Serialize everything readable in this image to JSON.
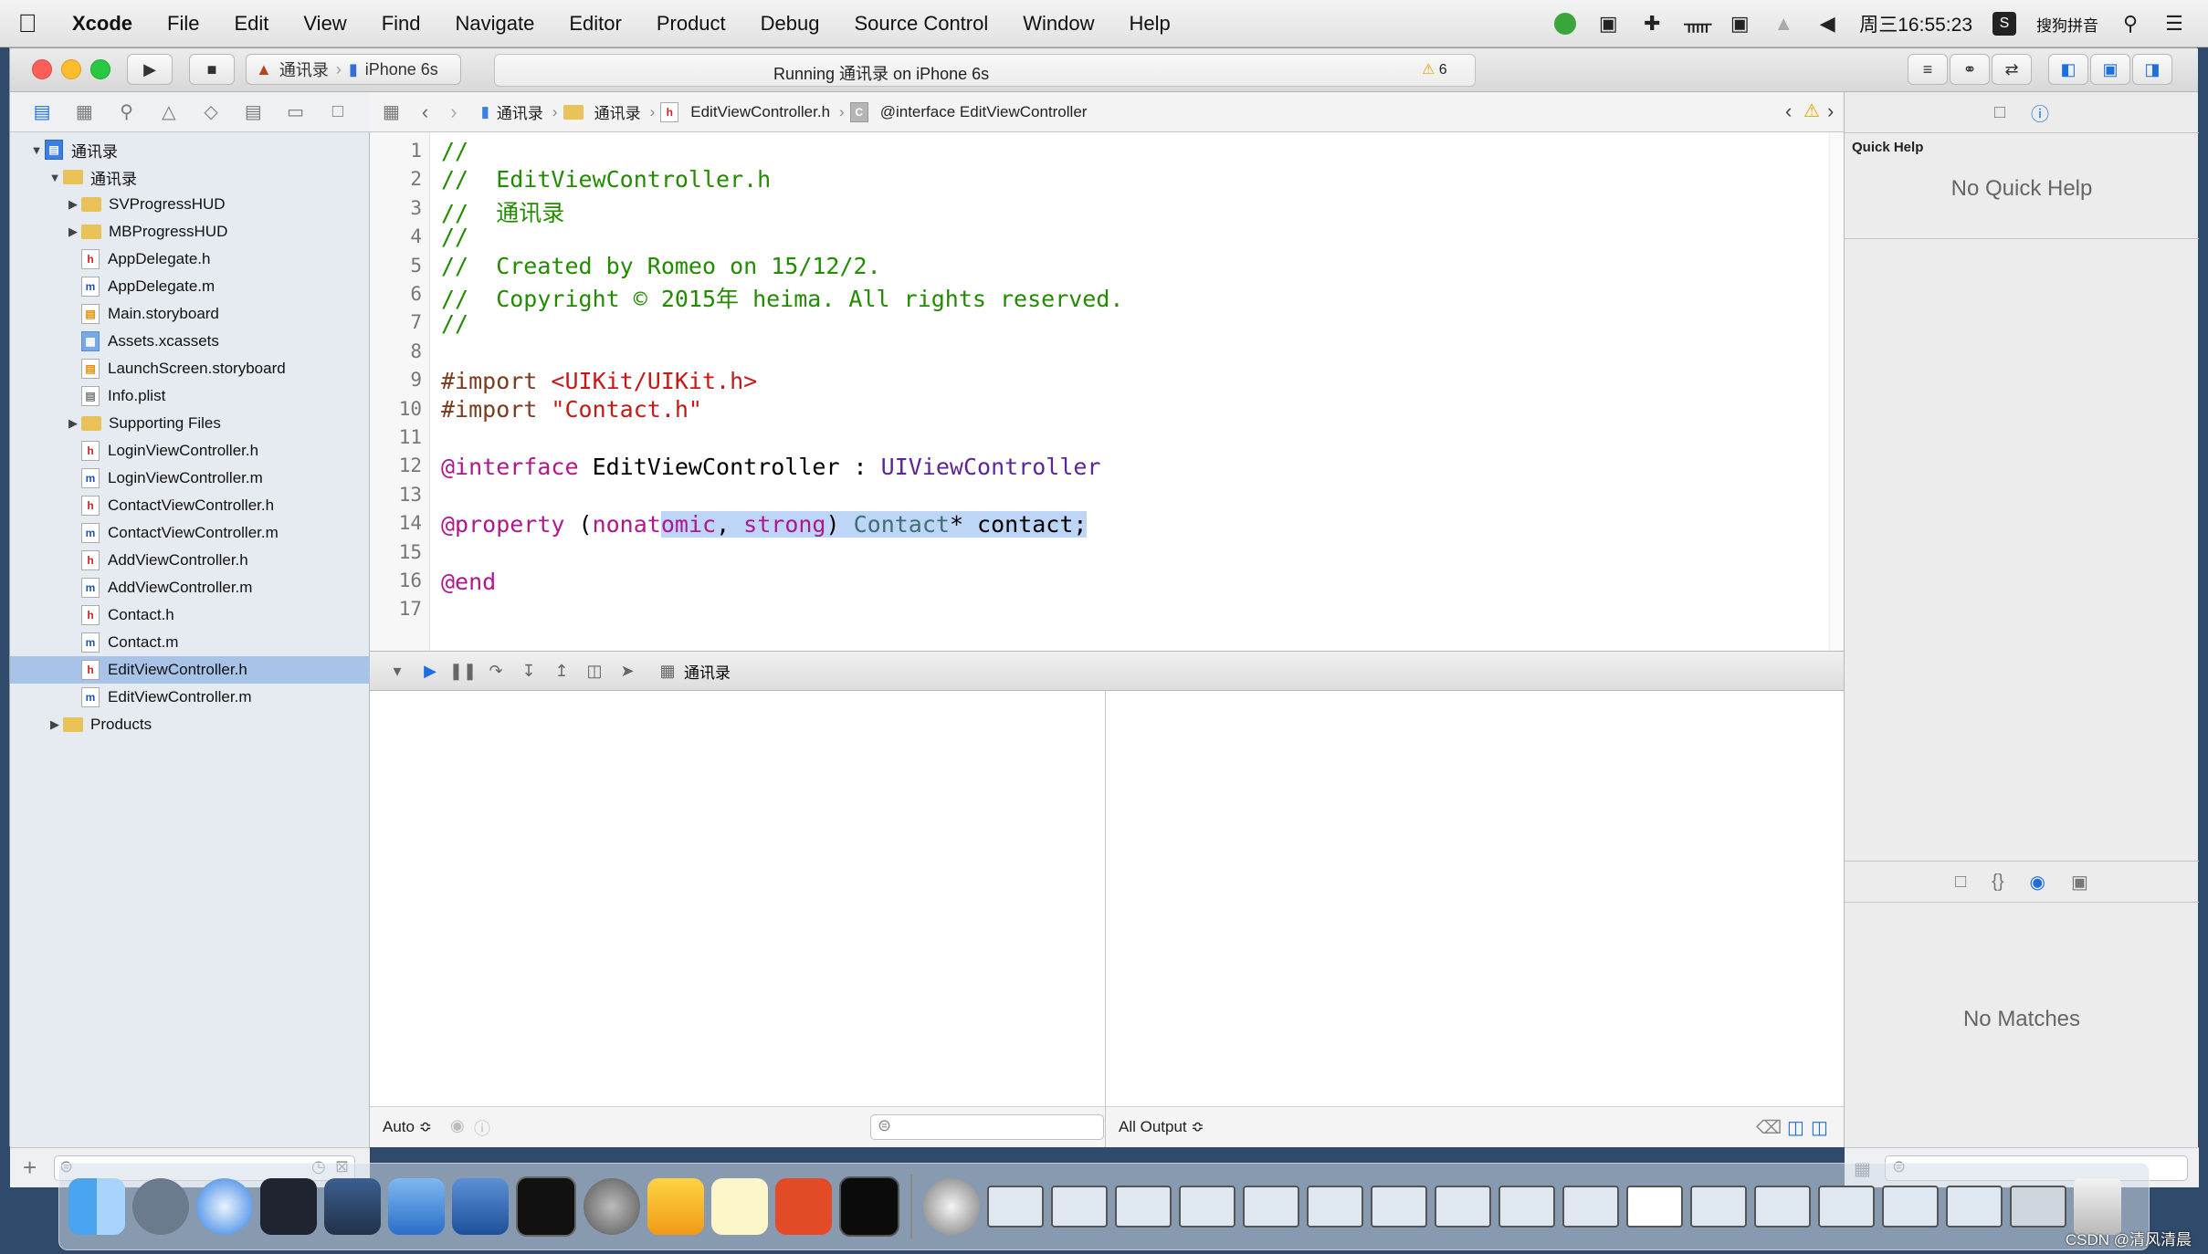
{
  "menubar": {
    "apple": "",
    "items": [
      "Xcode",
      "File",
      "Edit",
      "View",
      "Find",
      "Navigate",
      "Editor",
      "Product",
      "Debug",
      "Source Control",
      "Window",
      "Help"
    ],
    "clock": "周三16:55:23",
    "input_method": "搜狗拼音"
  },
  "toolbar": {
    "scheme": "通讯录",
    "device": "iPhone 6s",
    "activity": "Running 通讯录 on iPhone 6s",
    "warning_count": "6"
  },
  "navigator": {
    "items": [
      {
        "label": "通讯录",
        "level": 0,
        "kind": "proj",
        "disclosure": "open"
      },
      {
        "label": "通讯录",
        "level": 1,
        "kind": "folder",
        "disclosure": "open"
      },
      {
        "label": "SVProgressHUD",
        "level": 2,
        "kind": "folder",
        "disclosure": "closed"
      },
      {
        "label": "MBProgressHUD",
        "level": 2,
        "kind": "folder",
        "disclosure": "closed"
      },
      {
        "label": "AppDelegate.h",
        "level": 2,
        "kind": "h"
      },
      {
        "label": "AppDelegate.m",
        "level": 2,
        "kind": "m"
      },
      {
        "label": "Main.storyboard",
        "level": 2,
        "kind": "sb"
      },
      {
        "label": "Assets.xcassets",
        "level": 2,
        "kind": "as"
      },
      {
        "label": "LaunchScreen.storyboard",
        "level": 2,
        "kind": "sb"
      },
      {
        "label": "Info.plist",
        "level": 2,
        "kind": "pl"
      },
      {
        "label": "Supporting Files",
        "level": 2,
        "kind": "folder",
        "disclosure": "closed"
      },
      {
        "label": "LoginViewController.h",
        "level": 2,
        "kind": "h"
      },
      {
        "label": "LoginViewController.m",
        "level": 2,
        "kind": "m"
      },
      {
        "label": "ContactViewController.h",
        "level": 2,
        "kind": "h"
      },
      {
        "label": "ContactViewController.m",
        "level": 2,
        "kind": "m"
      },
      {
        "label": "AddViewController.h",
        "level": 2,
        "kind": "h"
      },
      {
        "label": "AddViewController.m",
        "level": 2,
        "kind": "m"
      },
      {
        "label": "Contact.h",
        "level": 2,
        "kind": "h"
      },
      {
        "label": "Contact.m",
        "level": 2,
        "kind": "m"
      },
      {
        "label": "EditViewController.h",
        "level": 2,
        "kind": "h",
        "selected": true
      },
      {
        "label": "EditViewController.m",
        "level": 2,
        "kind": "m"
      },
      {
        "label": "Products",
        "level": 1,
        "kind": "folder",
        "disclosure": "closed"
      }
    ]
  },
  "jumpbar": {
    "crumbs": [
      "通讯录",
      "通讯录",
      "EditViewController.h",
      "@interface EditViewController"
    ]
  },
  "editor": {
    "line_numbers": [
      "1",
      "2",
      "3",
      "4",
      "5",
      "6",
      "7",
      "8",
      "9",
      "10",
      "11",
      "12",
      "13",
      "14",
      "15",
      "16",
      "17"
    ],
    "lines": {
      "l1": "//",
      "l2": "//  EditViewController.h",
      "l3": "//  通讯录",
      "l4": "//",
      "l5": "//  Created by Romeo on 15/12/2.",
      "l6": "//  Copyright © 2015年 heima. All rights reserved.",
      "l7": "//",
      "l9_kw": "#import",
      "l9_str": " <UIKit/UIKit.h>",
      "l10_kw": "#import",
      "l10_str": " \"Contact.h\"",
      "l12_kw": "@interface",
      "l12_name": " EditViewController : ",
      "l12_super": "UIViewController",
      "l14_kw": "@property",
      "l14_open": " (",
      "l14_non": "nonat",
      "l14_omic": "omic",
      "l14_comma": ", ",
      "l14_strong": "strong",
      "l14_close": ") ",
      "l14_type": "Contact",
      "l14_rest": "* contact;",
      "l16_kw": "@end"
    }
  },
  "debug": {
    "process": "通讯录",
    "variables_scope": "Auto ≎",
    "console_scope": "All Output ≎"
  },
  "utilities": {
    "quick_help_title": "Quick Help",
    "quick_help_empty": "No Quick Help",
    "library_empty": "No Matches"
  },
  "watermark": "CSDN @清风清晨"
}
